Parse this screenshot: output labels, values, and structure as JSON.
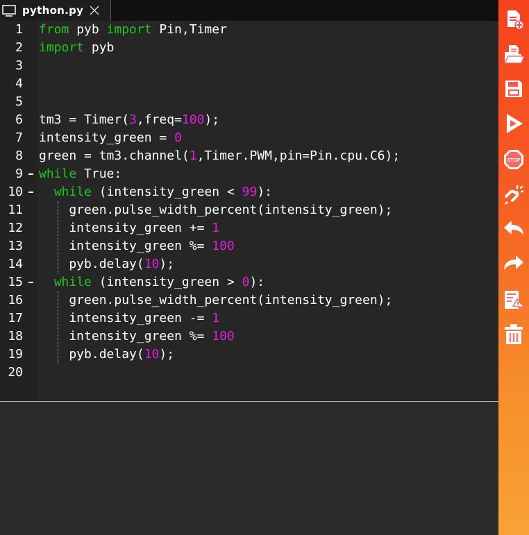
{
  "tab": {
    "filename": "python.py"
  },
  "editor": {
    "lines": [
      {
        "num": "1",
        "tokens": [
          [
            "kw",
            "from"
          ],
          [
            "t",
            " pyb "
          ],
          [
            "kw",
            "import"
          ],
          [
            "t",
            " Pin,Timer"
          ]
        ]
      },
      {
        "num": "2",
        "tokens": [
          [
            "kw",
            "import"
          ],
          [
            "t",
            " pyb"
          ]
        ]
      },
      {
        "num": "3",
        "tokens": []
      },
      {
        "num": "4",
        "tokens": []
      },
      {
        "num": "5",
        "tokens": []
      },
      {
        "num": "6",
        "tokens": [
          [
            "t",
            "tm3 = Timer("
          ],
          [
            "num",
            "3"
          ],
          [
            "t",
            ",freq="
          ],
          [
            "num",
            "100"
          ],
          [
            "t",
            ");"
          ]
        ]
      },
      {
        "num": "7",
        "tokens": [
          [
            "t",
            "intensity_green = "
          ],
          [
            "num",
            "0"
          ]
        ]
      },
      {
        "num": "8",
        "tokens": [
          [
            "t",
            "green = tm3.channel("
          ],
          [
            "num",
            "1"
          ],
          [
            "t",
            ",Timer.PWM,pin=Pin.cpu.C6);"
          ]
        ]
      },
      {
        "num": "9",
        "fold": true,
        "tokens": [
          [
            "kw",
            "while"
          ],
          [
            "t",
            " True:"
          ]
        ]
      },
      {
        "num": "10",
        "fold": true,
        "tokens": [
          [
            "t",
            "  "
          ],
          [
            "kw",
            "while"
          ],
          [
            "t",
            " (intensity_green < "
          ],
          [
            "num",
            "99"
          ],
          [
            "t",
            "):"
          ]
        ]
      },
      {
        "num": "11",
        "tokens": [
          [
            "t",
            "    green.pulse_width_percent(intensity_green);"
          ]
        ]
      },
      {
        "num": "12",
        "tokens": [
          [
            "t",
            "    intensity_green += "
          ],
          [
            "num",
            "1"
          ]
        ]
      },
      {
        "num": "13",
        "tokens": [
          [
            "t",
            "    intensity_green %= "
          ],
          [
            "num",
            "100"
          ]
        ]
      },
      {
        "num": "14",
        "tokens": [
          [
            "t",
            "    pyb.delay("
          ],
          [
            "num",
            "10"
          ],
          [
            "t",
            ");"
          ]
        ]
      },
      {
        "num": "15",
        "fold": true,
        "tokens": [
          [
            "t",
            "  "
          ],
          [
            "kw",
            "while"
          ],
          [
            "t",
            " (intensity_green > "
          ],
          [
            "num",
            "0"
          ],
          [
            "t",
            "):"
          ]
        ]
      },
      {
        "num": "16",
        "tokens": [
          [
            "t",
            "    green.pulse_width_percent(intensity_green);"
          ]
        ]
      },
      {
        "num": "17",
        "tokens": [
          [
            "t",
            "    intensity_green -= "
          ],
          [
            "num",
            "1"
          ]
        ]
      },
      {
        "num": "18",
        "tokens": [
          [
            "t",
            "    intensity_green %= "
          ],
          [
            "num",
            "100"
          ]
        ]
      },
      {
        "num": "19",
        "tokens": [
          [
            "t",
            "    pyb.delay("
          ],
          [
            "num",
            "10"
          ],
          [
            "t",
            ");"
          ]
        ]
      },
      {
        "num": "20",
        "tokens": []
      }
    ]
  },
  "toolbar": {
    "tools": [
      {
        "name": "new-file-icon"
      },
      {
        "name": "open-folder-icon"
      },
      {
        "name": "save-icon"
      },
      {
        "name": "run-icon"
      },
      {
        "name": "stop-icon",
        "label": "STOP"
      },
      {
        "name": "disconnect-icon"
      },
      {
        "name": "undo-icon"
      },
      {
        "name": "redo-icon"
      },
      {
        "name": "clear-output-icon"
      },
      {
        "name": "delete-icon"
      }
    ]
  },
  "colors": {
    "keyword": "#1ec91e",
    "number": "#e020d8",
    "text": "#ffffff",
    "toolbar_top": "#f7421f",
    "toolbar_bottom": "#f8a235"
  }
}
